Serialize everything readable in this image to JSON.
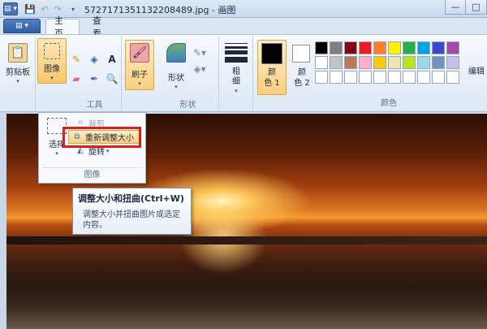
{
  "window": {
    "title": "5727171351132208489.jpg - 画图",
    "minimize": "—",
    "maximize": "□"
  },
  "quick_access": {
    "app_menu": "▤ ▾",
    "save": "💾",
    "undo": "↶",
    "redo": "↷",
    "more": "▾"
  },
  "tabs": [
    {
      "label": "主页"
    },
    {
      "label": "查看"
    }
  ],
  "ribbon": {
    "clipboard": {
      "label": "剪贴板"
    },
    "image": {
      "label": "图像"
    },
    "tools": {
      "label": "工具"
    },
    "brush": {
      "label": "刷子"
    },
    "shapes": {
      "label": "形状",
      "group_label": "形状"
    },
    "size": {
      "label": "粗\n细"
    },
    "color1": {
      "label": "颜\n色 1",
      "value": "#000000"
    },
    "color2": {
      "label": "颜\n色 2",
      "value": "#ffffff"
    },
    "colors_group": {
      "label": "颜色"
    },
    "edit_colors": {
      "label": "编辑"
    },
    "palette": [
      "#000000",
      "#7f7f7f",
      "#880015",
      "#ed1c24",
      "#ff7f27",
      "#fff200",
      "#22b14c",
      "#00a2e8",
      "#3f48cc",
      "#a349a4",
      "#ffffff",
      "#c3c3c3",
      "#b97a57",
      "#ffaec9",
      "#ffc90e",
      "#efe4b0",
      "#b5e61d",
      "#99d9ea",
      "#7092be",
      "#c8bfe7",
      "#ffffff",
      "#ffffff",
      "#ffffff",
      "#ffffff",
      "#ffffff",
      "#ffffff",
      "#ffffff",
      "#ffffff",
      "#ffffff",
      "#ffffff"
    ]
  },
  "image_menu": {
    "select_label": "选择",
    "crop_label": "裁剪",
    "resize_label": "重新调整大小",
    "rotate_label": "旋转",
    "group_label": "图像"
  },
  "tooltip": {
    "title": "调整大小和扭曲(Ctrl+W)",
    "body": "调整大小并扭曲图片或选定内容。"
  }
}
